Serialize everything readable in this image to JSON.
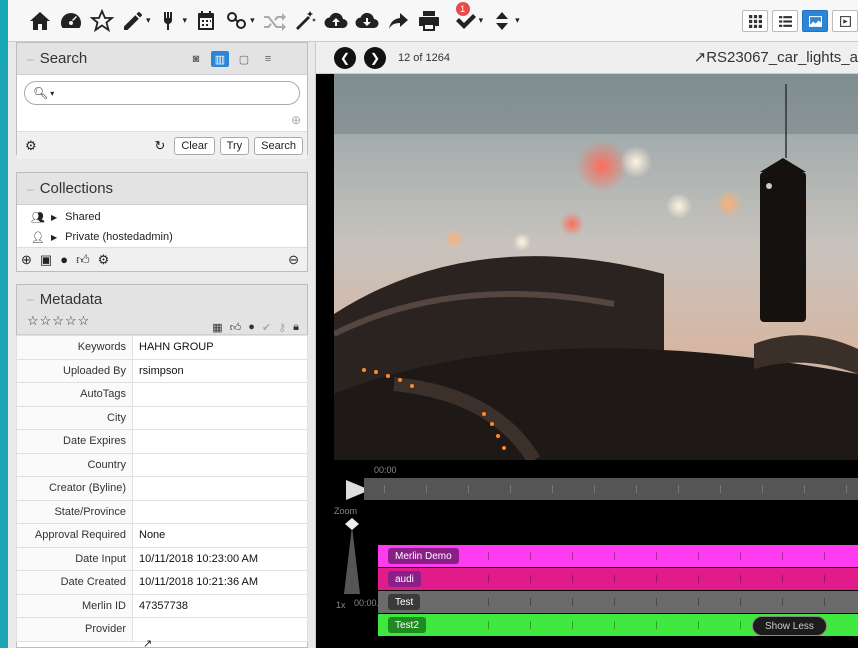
{
  "toolbar": {
    "icons": [
      "home-icon",
      "dashboard-icon",
      "star-icon",
      "edit-icon",
      "tool-icon",
      "calendar-icon",
      "link-icon",
      "shuffle-icon",
      "magic-wand-icon",
      "cloud-upload-icon",
      "cloud-download-icon",
      "share-icon",
      "print-icon",
      "check-icon",
      "sort-icon"
    ],
    "notification_count": "1"
  },
  "search": {
    "title": "Search",
    "clear_label": "Clear",
    "try_label": "Try",
    "search_label": "Search"
  },
  "collections": {
    "title": "Collections",
    "items": [
      {
        "label": "Shared"
      },
      {
        "label": "Private (hostedadmin)"
      }
    ]
  },
  "metadata": {
    "title": "Metadata",
    "stars": "☆☆☆☆☆",
    "rows": [
      {
        "key": "Keywords",
        "value": "HAHN GROUP"
      },
      {
        "key": "Uploaded By",
        "value": "rsimpson"
      },
      {
        "key": "AutoTags",
        "value": ""
      },
      {
        "key": "City",
        "value": ""
      },
      {
        "key": "Date Expires",
        "value": ""
      },
      {
        "key": "Country",
        "value": ""
      },
      {
        "key": "Creator (Byline)",
        "value": ""
      },
      {
        "key": "State/Province",
        "value": ""
      },
      {
        "key": "Approval Required",
        "value": "None"
      },
      {
        "key": "Date Input",
        "value": "10/11/2018 10:23:00 AM"
      },
      {
        "key": "Date Created",
        "value": "10/11/2018 10:21:36 AM"
      },
      {
        "key": "Merlin ID",
        "value": "47357738"
      },
      {
        "key": "Provider",
        "value": ""
      }
    ]
  },
  "viewer": {
    "counter": "12 of 1264",
    "file_name": "RS23067_car_lights_a",
    "time_start": "00:00",
    "zoom_label": "Zoom",
    "zoom_level": "1x",
    "time_origin": "00:00.0",
    "show_less_label": "Show Less",
    "tracks": [
      {
        "label": "Merlin Demo",
        "color": "#ff3cf0",
        "label_color": "#8a1f8a"
      },
      {
        "label": "audi",
        "color": "#e01c8a",
        "label_color": "#8a1f8a"
      },
      {
        "label": "Test",
        "color": "#6b6b6b",
        "label_color": "#3a3a3a"
      },
      {
        "label": "Test2",
        "color": "#3ee83e",
        "label_color": "#1f8a1f"
      }
    ]
  }
}
